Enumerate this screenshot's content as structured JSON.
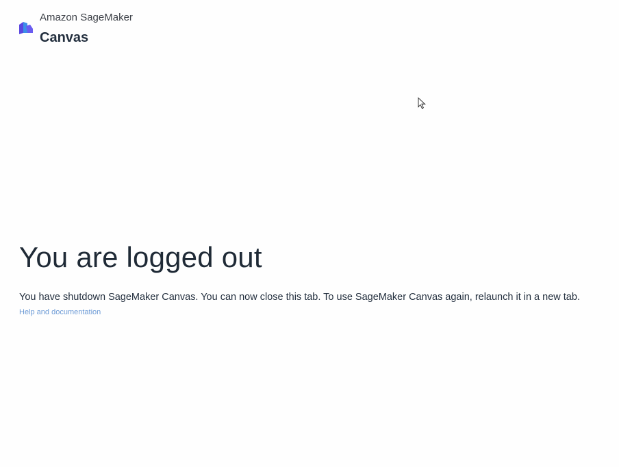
{
  "header": {
    "product_name": "Amazon SageMaker",
    "app_title": "Canvas",
    "logo_icon": "sagemaker-canvas-logo"
  },
  "main": {
    "headline": "You are logged out",
    "message": "You have shutdown SageMaker Canvas. You can now close this tab. To use SageMaker Canvas again, relaunch it in a new tab.",
    "help_link_label": "Help and documentation"
  },
  "colors": {
    "logo_primary": "#5a46e0",
    "logo_secondary": "#3c8fe8",
    "link": "#6d9bd6",
    "text": "#232f3e"
  }
}
